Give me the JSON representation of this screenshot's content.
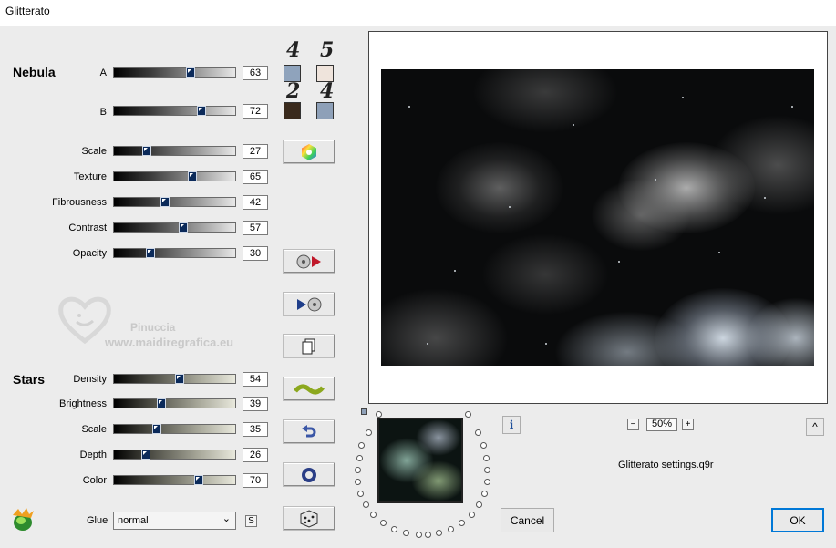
{
  "window": {
    "title": "Glitterato"
  },
  "nebula": {
    "section_label": "Nebula",
    "A": {
      "label": "A",
      "value": "63",
      "level": 63
    },
    "B": {
      "label": "B",
      "value": "72",
      "level": 72
    },
    "color_labels": [
      "4",
      "5",
      "2",
      "4"
    ],
    "swatches": [
      "#8fa3bc",
      "#efe4dc",
      "#3a2a1c",
      "#8ea0b8"
    ]
  },
  "params": [
    {
      "label": "Scale",
      "value": "27",
      "level": 27
    },
    {
      "label": "Texture",
      "value": "65",
      "level": 65
    },
    {
      "label": "Fibrousness",
      "value": "42",
      "level": 42
    },
    {
      "label": "Contrast",
      "value": "57",
      "level": 57
    },
    {
      "label": "Opacity",
      "value": "30",
      "level": 30
    }
  ],
  "watermark": {
    "name": "Pinuccia",
    "url": "www.maidiregrafica.eu"
  },
  "stars": {
    "section_label": "Stars",
    "items": [
      {
        "label": "Density",
        "value": "54",
        "level": 54
      },
      {
        "label": "Brightness",
        "value": "39",
        "level": 39
      },
      {
        "label": "Scale",
        "value": "35",
        "level": 35
      },
      {
        "label": "Depth",
        "value": "26",
        "level": 26
      },
      {
        "label": "Color",
        "value": "70",
        "level": 70
      }
    ]
  },
  "glue": {
    "label": "Glue",
    "selected": "normal",
    "s_button": "S"
  },
  "preview": {
    "zoom": "50%",
    "zoom_minus": "−",
    "zoom_plus": "+",
    "settings_file": "Glitterato settings.q9r"
  },
  "buttons": {
    "cancel": "Cancel",
    "ok": "OK",
    "info": "i",
    "collapse": "^"
  },
  "icons": [
    "color-wheel-icon",
    "export-icon",
    "import-icon",
    "copy-icon",
    "wave-icon",
    "undo-icon",
    "ring-icon",
    "dice-icon",
    "logo-icon"
  ]
}
